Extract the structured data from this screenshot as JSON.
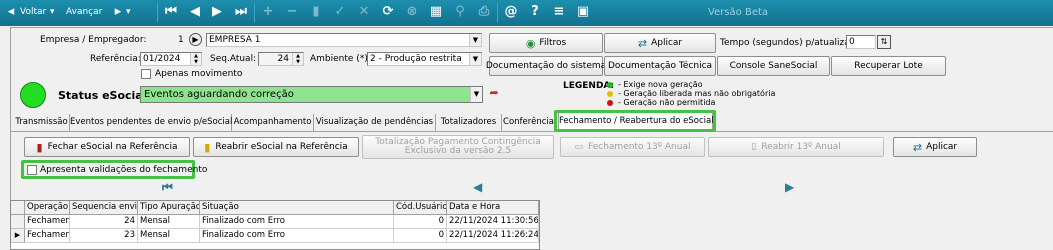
{
  "toolbar": {
    "back_label": "Voltar",
    "forward_label": "Avançar",
    "version_label": "Versão Beta"
  },
  "form": {
    "empresa_label": "Empresa / Empregador:",
    "empresa_code": "1",
    "empresa_name": "EMPRESA 1",
    "referencia_label": "Referência:",
    "referencia_value": "01/2024",
    "seq_label": "Seq.Atual:",
    "seq_value": "24",
    "ambiente_label": "Ambiente (*):",
    "ambiente_value": "2 - Produção restrita",
    "apenas_label": "Apenas movimento",
    "status_label": "Status eSocial:",
    "status_value": "Eventos aguardando correção",
    "tempo_label": "Tempo (segundos) p/atualizar:",
    "tempo_value": "0"
  },
  "buttons": {
    "filtros": "Filtros",
    "aplicar": "Aplicar",
    "doc_sistema": "Documentação do sistema",
    "doc_tecnica": "Documentação Técnica",
    "console": "Console SaneSocial",
    "recuperar": "Recuperar Lote"
  },
  "legend": {
    "title": "LEGENDA:",
    "items": [
      {
        "text": "- Exige nova geração",
        "color": "#22bb22"
      },
      {
        "text": "- Geração liberada mas não obrigatória",
        "color": "#e0c000"
      },
      {
        "text": "- Geração não permitida",
        "color": "#cc1111"
      }
    ]
  },
  "tabs": [
    "Transmissão",
    "Eventos pendentes de envio p/eSocial",
    "Acompanhamento",
    "Visualização de pendências",
    "Totalizadores",
    "Conferência",
    "Fechamento / Reabertura do eSocial"
  ],
  "actions": {
    "fechar": "Fechar eSocial na Referência",
    "reabrir": "Reabrir eSocial na Referência",
    "totalizacao_line1": "Totalização Pagamento Contingência",
    "totalizacao_line2": "Exclusivo da versão 2.5",
    "fechamento13": "Fechamento 13º Anual",
    "reabrir13": "Reabrir 13º Anual",
    "aplicar": "Aplicar",
    "validacoes": "Apresenta validações do fechamento"
  },
  "grid": {
    "columns": [
      "Operação",
      "Sequencia envio",
      "Tipo Apuração",
      "Situação",
      "Cód.Usuário",
      "Data e Hora"
    ],
    "rows": [
      [
        "Fechamen",
        "24",
        "Mensal",
        "Finalizado com Erro",
        "0",
        "22/11/2024 11:30:56"
      ],
      [
        "Fechamen",
        "23",
        "Mensal",
        "Finalizado com Erro",
        "0",
        "22/11/2024 11:26:24"
      ]
    ]
  },
  "colors": {
    "toolbar": "#1d8fae",
    "highlight": "#43c243",
    "status_ok": "#22dd22"
  }
}
